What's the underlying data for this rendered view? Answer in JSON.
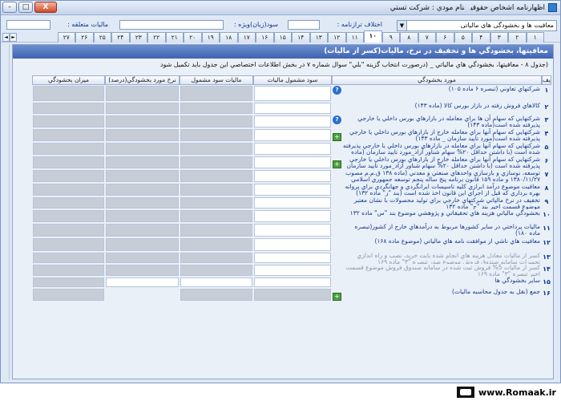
{
  "app": {
    "title_parts": [
      "اظهارنامه اشخاص حقوقي",
      "نام مودي : شركت تستي"
    ],
    "window_buttons": [
      "-",
      "□",
      "X"
    ]
  },
  "infobar": {
    "category_select": "معافیت ها و بخشودگی های مالیاتی",
    "category_arrow": "▼",
    "tax_dispute_label": "اختلاف ترازنامه :",
    "taxable_special_profit_label": "سود(زیان)ویژه :",
    "tax_payable_label": "ماليات متعلقه :"
  },
  "tabs": [
    "1",
    "2",
    "3",
    "4",
    "5",
    "6",
    "7",
    "8",
    "9",
    "10",
    "11",
    "12",
    "13",
    "14",
    "15",
    "16",
    "17",
    "18",
    "19",
    "20",
    "21",
    "22",
    "23",
    "24",
    "25",
    "26",
    "27"
  ],
  "tab_labels_display": [
    "١",
    "٢",
    "٣",
    "۴",
    "۵",
    "۶",
    "٧",
    "٨",
    "٩",
    "١٠",
    "١١",
    "١٢",
    "١٣",
    "١۴",
    "١۵",
    "١۶",
    "١٧",
    "١٨",
    "١٩",
    "٢٠",
    "٢١",
    "٢٢",
    "٢٣",
    "٢۴",
    "٢۵",
    "٢۶",
    "٢٧"
  ],
  "active_tab_index": 9,
  "tab_nav": [
    "◄",
    "►"
  ],
  "panel": {
    "title": "معافيتها، بخشودگي ها و تخفيف در نرخ، ماليات(كسر از ماليات)",
    "description": "(جدول ۸ - معافيتها، بخشودگي هاي مالياتي _ (درصورت انتخاب گزينه \"بلي\" سوال شماره ۷ در بخش اطلاعات اختصاصي اين جدول بايد تكميل شود"
  },
  "grid": {
    "headers": [
      "رديف",
      "مورد بخشودگي",
      "سود مشمول ماليات",
      "ماليات سود مشمول",
      "نرخ مورد بخشودگي(درصد)",
      "ميزان بخشودگي"
    ],
    "rows": [
      {
        "num": "١",
        "text": "شركتهاي تعاوني (تبصره ۶ ماده ۱۰۵)",
        "h": 21,
        "help": true,
        "add": false,
        "cells": [
          "w",
          "g",
          "g",
          "g"
        ]
      },
      {
        "num": "٢",
        "text": "كالاهاي فروش رفته در بازار بورس كالا (ماده ۱۴۳)",
        "h": 16,
        "help": false,
        "add": false,
        "cells": [
          "w",
          "g",
          "g",
          "g"
        ]
      },
      {
        "num": "٣",
        "text": "شركتهايي كه سهام آن ها براي معامله در بازارهاي بورس داخلي يا خارجي پذيرفته شده است(ماده ۱۴۳)",
        "h": 17,
        "help": true,
        "add": false,
        "cells": [
          "w",
          "g",
          "g",
          "g"
        ]
      },
      {
        "num": "۴",
        "text": "شركتهايي كه سهام آنها براي معامله خارج از بازارهاي بورس داخلي يا خارجي پذيرفته شده است(مورد تاييد سازمان _ ماده ۱۴۳)",
        "h": 17,
        "help": false,
        "add": true,
        "cells": [
          "w",
          "g",
          "g",
          "g"
        ]
      },
      {
        "num": "۵",
        "text": "شركتهايي كه سهام آنها براي معامله در بازارهاي بورس داخلي يا خارجي پذيرفته شده است (با داشتن حداقل ۲۰% سهام شناور آزاد_مورد تاييد سازمان (ماده ۱۴۳))",
        "h": 17,
        "help": false,
        "add": false,
        "cells": [
          "w",
          "g",
          "g",
          "g"
        ]
      },
      {
        "num": "۶",
        "text": "شركتهايي كه سهام آنها براي معامله خارج از بازارهاي بورس داخلي يا خارجي پذيرفته شده است (با داشتن حداقل ۲۰% سهام شناور آزاد_مورد تاييد سازمان (ماده ۱۴۳))",
        "h": 17,
        "help": false,
        "add": true,
        "cells": [
          "w",
          "g",
          "g",
          "g"
        ]
      },
      {
        "num": "٧",
        "text": "توسعه، نوسازي و بازسازي واحدهاي صنعتي و معدني (ماده ۱۳۸ ق.م.م مصوب ۱۳۸۰/۱۱/۲۷ و ماده ۱۵۹ قانون برنامه پنج ساله پنجم توسعه جمهوري اسلامي ايران)",
        "h": 17,
        "help": false,
        "add": false,
        "cells": [
          "w",
          "g",
          "g",
          "g"
        ]
      },
      {
        "num": "٨",
        "text": "معافيت موضوع درآمد ابرازي كليه تاسيسات ايرانگردي و جهانگردي براي پروانه بهره برداري كه قبل از اجراي اين قانون اخذ شده است (بند \"ز\" ماده ۱۳۲)",
        "h": 17,
        "help": false,
        "add": false,
        "cells": [
          "w",
          "g",
          "g",
          "g"
        ]
      },
      {
        "num": "٩",
        "text": "تخفيف در نرخ مالياتي شركتهاي خارجي براي توليد محصولات با نشان معتبر موضوع قسمت اخير بند \"ج\" ماده ۱۳۲",
        "h": 16,
        "help": false,
        "add": false,
        "cells": [
          "w",
          "g",
          "g",
          "g"
        ]
      },
      {
        "num": "١٠",
        "text": "بخشودگي مالياتي هزينه هاي تحقيقاتي و پژوهشي موضوع بند \"س\" ماده ۱۳۲",
        "h": 17,
        "help": false,
        "add": false,
        "cells": [
          "w",
          "g",
          "g",
          "g"
        ]
      },
      {
        "num": "١١",
        "text": "ماليات پرداختي در ساير كشورها مربوط به درآمدهاي خارج از كشور(تبصره ماده ۱۸۰)",
        "h": 18,
        "help": false,
        "add": false,
        "cells": [
          "w",
          "g",
          "g",
          "g"
        ]
      },
      {
        "num": "١٢",
        "text": "معافيت هاي ناشي از موافقت نامه هاي مالياتي (موضوع ماده ۱۶۸)",
        "h": 18,
        "help": false,
        "add": false,
        "cells": [
          "w",
          "g",
          "g",
          "g"
        ]
      },
      {
        "num": "١٣",
        "text": "كسر از ماليات معادل هزينه هاي انجام شده بابت خريد، نصب و راه اندازي تجهيزات سامانه صندوق فروش موضوع صدر تبصره \"۳\" ماده ۱۶۹",
        "h": 15,
        "help": false,
        "add": false,
        "disabled": true,
        "cells": [
          "w",
          "g",
          "g",
          "g"
        ]
      },
      {
        "num": "١۴",
        "text": "كسر از ماليات 5% فروش ثبت شده در سامانه صندوق فروش موضوع قسمت اخير تبصره \"۳\" ماده ۱۶۹",
        "h": 16,
        "help": false,
        "add": false,
        "disabled": true,
        "cells": [
          "w",
          "g",
          "g",
          "g"
        ]
      },
      {
        "num": "١۵",
        "text": "ساير بخشودگي ها",
        "h": 14,
        "help": false,
        "add": false,
        "cells": [
          "w",
          "w",
          "w",
          "g"
        ]
      },
      {
        "num": "١۶",
        "text": "جمع (نقل به جدول محاسبه ماليات)",
        "h": 17,
        "help": false,
        "add": true,
        "cells": [
          "g",
          "g",
          "none",
          "g"
        ]
      }
    ]
  },
  "footer": {
    "brand": "www.Romaak.ir"
  }
}
